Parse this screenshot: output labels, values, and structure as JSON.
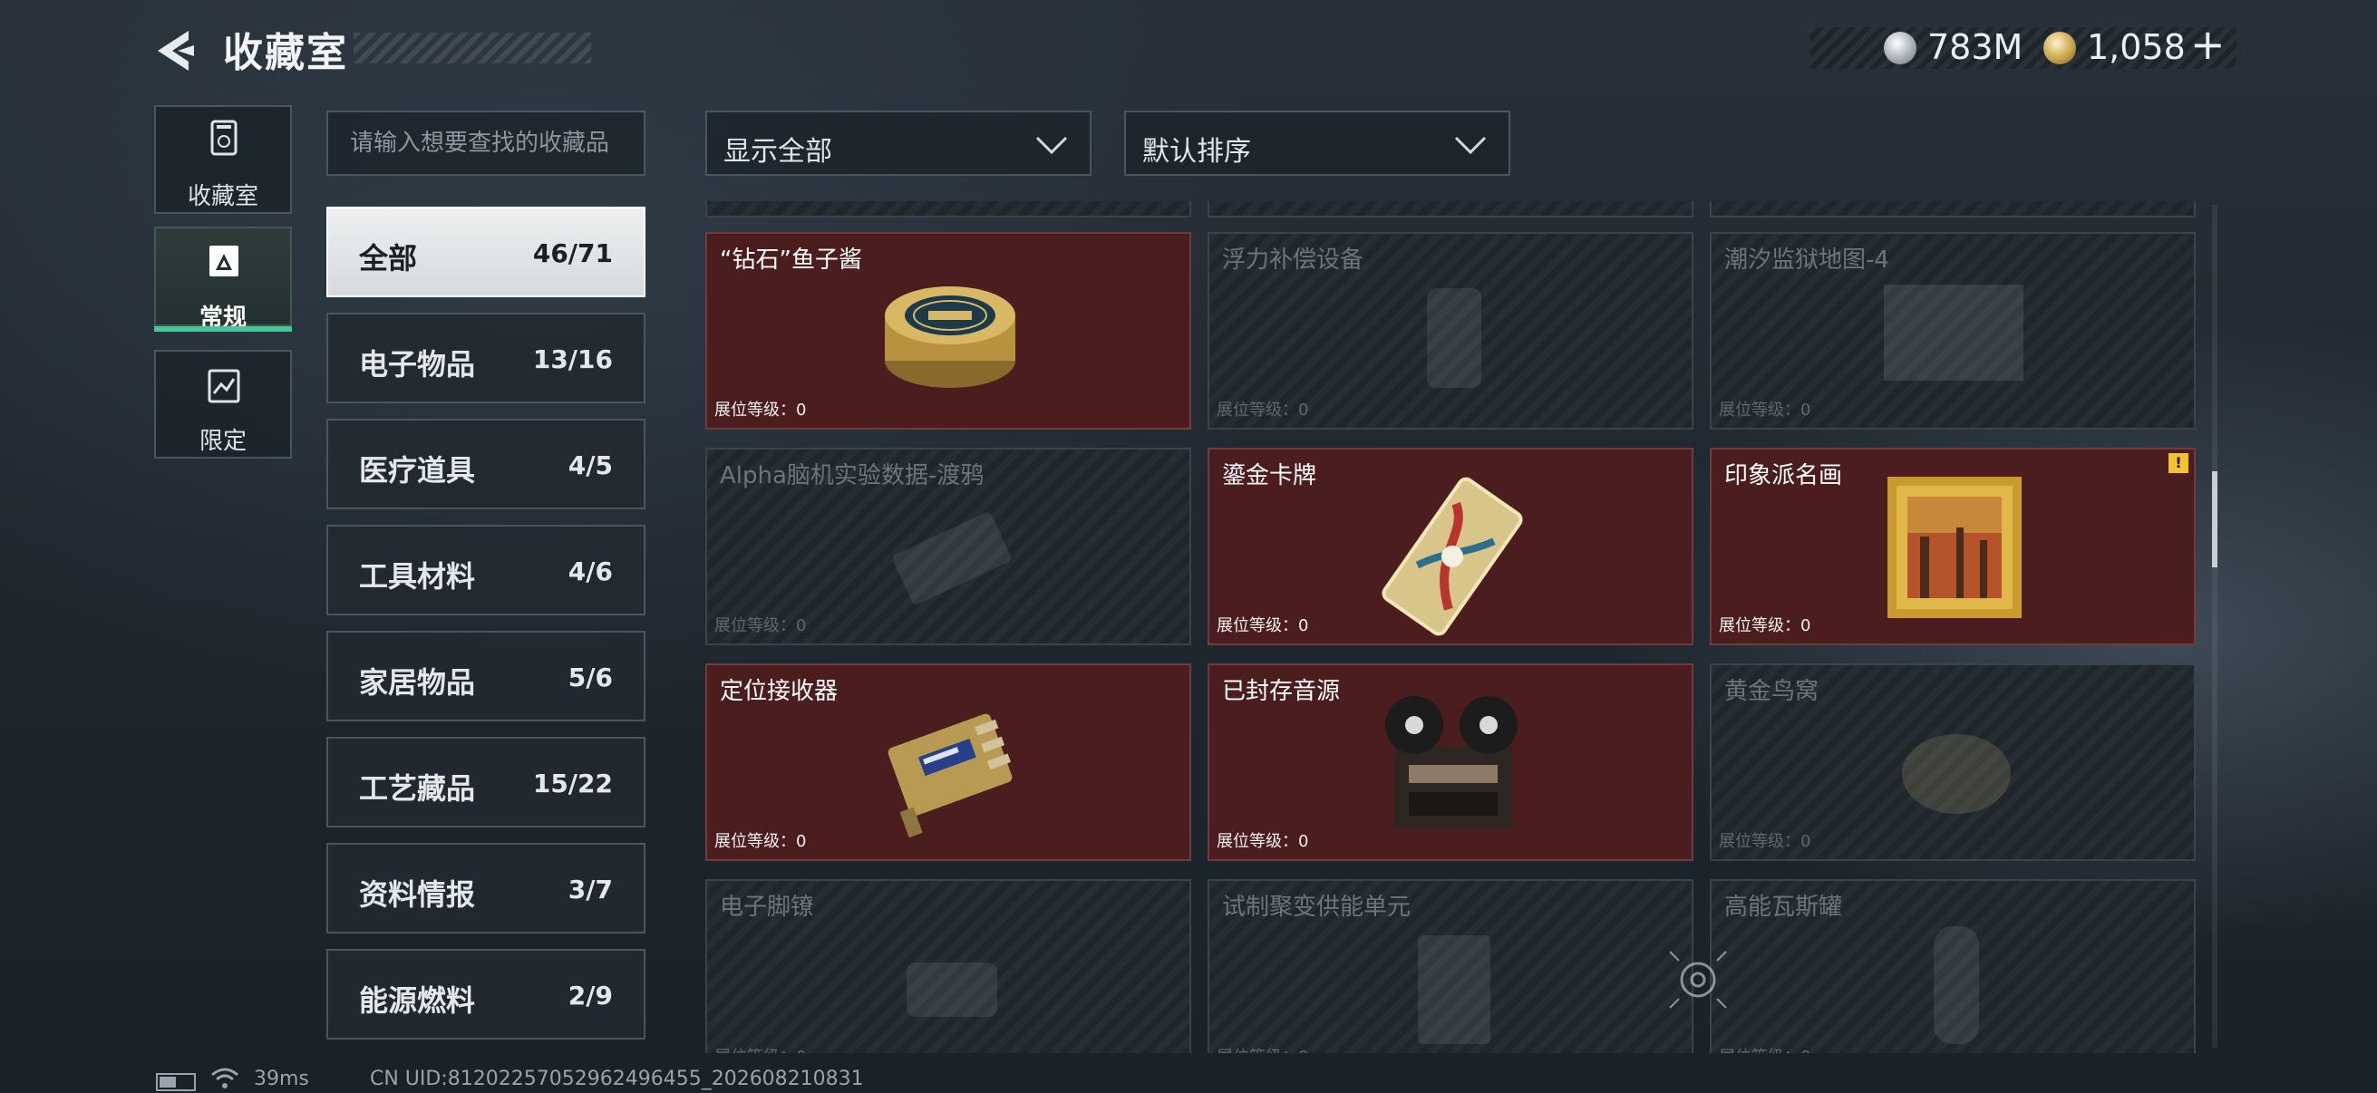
{
  "header": {
    "title": "收藏室",
    "currency_silver": "783M",
    "currency_gold": "1,058",
    "add_label": "+"
  },
  "side_tabs": [
    {
      "label": "收藏室",
      "icon": "collection-icon",
      "active": false
    },
    {
      "label": "常规",
      "icon": "regular-icon",
      "active": true
    },
    {
      "label": "限定",
      "icon": "limited-icon",
      "active": false
    }
  ],
  "search": {
    "placeholder": "请输入想要查找的收藏品"
  },
  "filters": {
    "display": "显示全部",
    "sort": "默认排序"
  },
  "categories": [
    {
      "name": "全部",
      "count": "46/71",
      "active": true
    },
    {
      "name": "电子物品",
      "count": "13/16"
    },
    {
      "name": "医疗道具",
      "count": "4/5"
    },
    {
      "name": "工具材料",
      "count": "4/6"
    },
    {
      "name": "家居物品",
      "count": "5/6"
    },
    {
      "name": "工艺藏品",
      "count": "15/22"
    },
    {
      "name": "资料情报",
      "count": "3/7"
    },
    {
      "name": "能源燃料",
      "count": "2/9"
    }
  ],
  "level_label": "展位等级：0",
  "items": [
    {
      "name": "“钻石”鱼子酱",
      "owned": true,
      "icon": "caviar-tin-icon"
    },
    {
      "name": "浮力补偿设备",
      "owned": false,
      "icon": "buoyancy-device-icon"
    },
    {
      "name": "潮汐监狱地图-4",
      "owned": false,
      "icon": "map-icon"
    },
    {
      "name": "Alpha脑机实验数据-渡鸦",
      "owned": false,
      "icon": "data-drive-icon"
    },
    {
      "name": "鎏金卡牌",
      "owned": true,
      "icon": "gilded-card-icon"
    },
    {
      "name": "印象派名画",
      "owned": true,
      "icon": "framed-painting-icon",
      "alert": "!"
    },
    {
      "name": "定位接收器",
      "owned": true,
      "icon": "locator-receiver-icon"
    },
    {
      "name": "已封存音源",
      "owned": true,
      "icon": "reel-tape-recorder-icon"
    },
    {
      "name": "黄金鸟窝",
      "owned": false,
      "icon": "golden-nest-icon"
    },
    {
      "name": "电子脚镣",
      "owned": false,
      "icon": "ankle-monitor-icon"
    },
    {
      "name": "试制聚变供能单元",
      "owned": false,
      "icon": "fusion-cell-icon"
    },
    {
      "name": "高能瓦斯罐",
      "owned": false,
      "icon": "gas-canister-icon"
    }
  ],
  "status_bar": {
    "ping": "39ms",
    "uid": "CN UID:8120225705296249645​5_202608210831"
  }
}
